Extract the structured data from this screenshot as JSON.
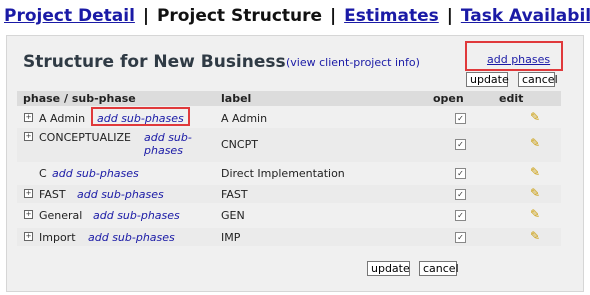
{
  "nav": {
    "project_detail": "Project Detail",
    "project_structure": "Project Structure",
    "estimates": "Estimates",
    "task_availability": "Task Availability",
    "separator": "|"
  },
  "panel": {
    "title": "Structure for New Business",
    "view_client_project": "(view client-project info)",
    "add_phases": "add phases",
    "update_label": "update",
    "cancel_label": "cancel"
  },
  "table": {
    "headers": {
      "phase": "phase / sub-phase",
      "label": "label",
      "open": "open",
      "edit": "edit"
    },
    "add_sub_phases_label": "add sub-phases",
    "rows": [
      {
        "name": "A Admin",
        "label": "A Admin",
        "open": true
      },
      {
        "name": "CONCEPTUALIZE",
        "label": "CNCPT",
        "open": true
      },
      {
        "name": "C",
        "label": "Direct Implementation",
        "open": true
      },
      {
        "name": "FAST",
        "label": "FAST",
        "open": true
      },
      {
        "name": "General",
        "label": "GEN",
        "open": true
      },
      {
        "name": "Import",
        "label": "IMP",
        "open": true
      }
    ]
  },
  "colors": {
    "link": "#1a1aa6",
    "highlight": "#e0393b",
    "panel_bg": "#f0f0f0",
    "header_bg": "#dcdcdc"
  }
}
